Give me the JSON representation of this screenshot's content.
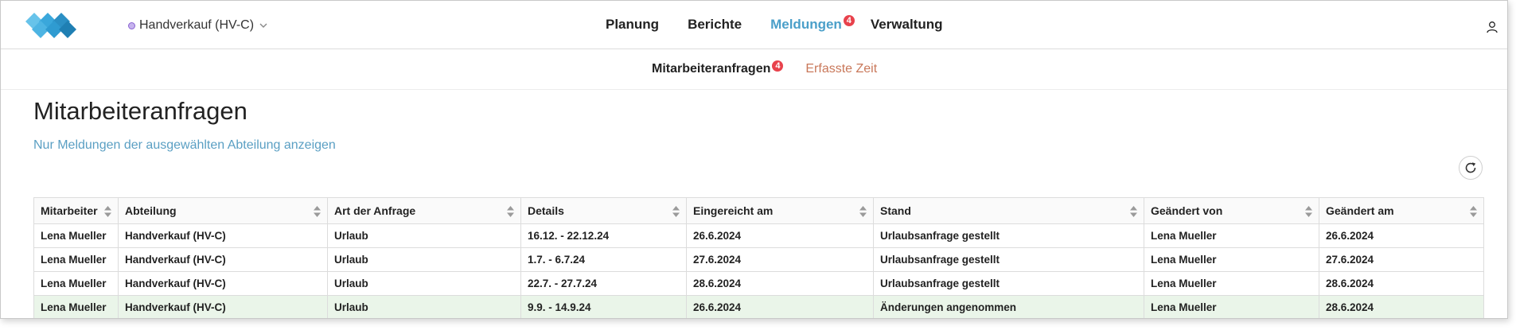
{
  "app": {
    "department": "Handverkauf (HV-C)",
    "colors": {
      "accent": "#4a9fc9",
      "badge": "#e8424c",
      "secondary_link": "#c9785a",
      "highlight_row": "#eaf5e9",
      "logo": "#3aa7db"
    }
  },
  "nav": {
    "items": [
      {
        "label": "Planung",
        "active": false,
        "badge": ""
      },
      {
        "label": "Berichte",
        "active": false,
        "badge": ""
      },
      {
        "label": "Meldungen",
        "active": true,
        "badge": "4"
      },
      {
        "label": "Verwaltung",
        "active": false,
        "badge": ""
      }
    ],
    "user_icon": "user-icon"
  },
  "subnav": {
    "tabs": [
      {
        "label": "Mitarbeiteranfragen",
        "badge": "4",
        "active": true
      },
      {
        "label": "Erfasste Zeit",
        "active": false
      }
    ]
  },
  "page": {
    "title": "Mitarbeiteranfragen",
    "filter_link": "Nur Meldungen der ausgewählten Abteilung anzeigen",
    "refresh_icon": "refresh-icon"
  },
  "table": {
    "columns": [
      "Mitarbeiter",
      "Abteilung",
      "Art der Anfrage",
      "Details",
      "Eingereicht am",
      "Stand",
      "Geändert von",
      "Geändert am"
    ],
    "rows": [
      [
        "Lena Mueller",
        "Handverkauf (HV-C)",
        "Urlaub",
        "16.12. - 22.12.24",
        "26.6.2024",
        "Urlaubsanfrage gestellt",
        "Lena Mueller",
        "26.6.2024"
      ],
      [
        "Lena Mueller",
        "Handverkauf (HV-C)",
        "Urlaub",
        "1.7. - 6.7.24",
        "27.6.2024",
        "Urlaubsanfrage gestellt",
        "Lena Mueller",
        "27.6.2024"
      ],
      [
        "Lena Mueller",
        "Handverkauf (HV-C)",
        "Urlaub",
        "22.7. - 27.7.24",
        "28.6.2024",
        "Urlaubsanfrage gestellt",
        "Lena Mueller",
        "28.6.2024"
      ],
      [
        "Lena Mueller",
        "Handverkauf (HV-C)",
        "Urlaub",
        "9.9. - 14.9.24",
        "26.6.2024",
        "Änderungen angenommen",
        "Lena Mueller",
        "28.6.2024"
      ]
    ],
    "highlighted_row": 3
  }
}
